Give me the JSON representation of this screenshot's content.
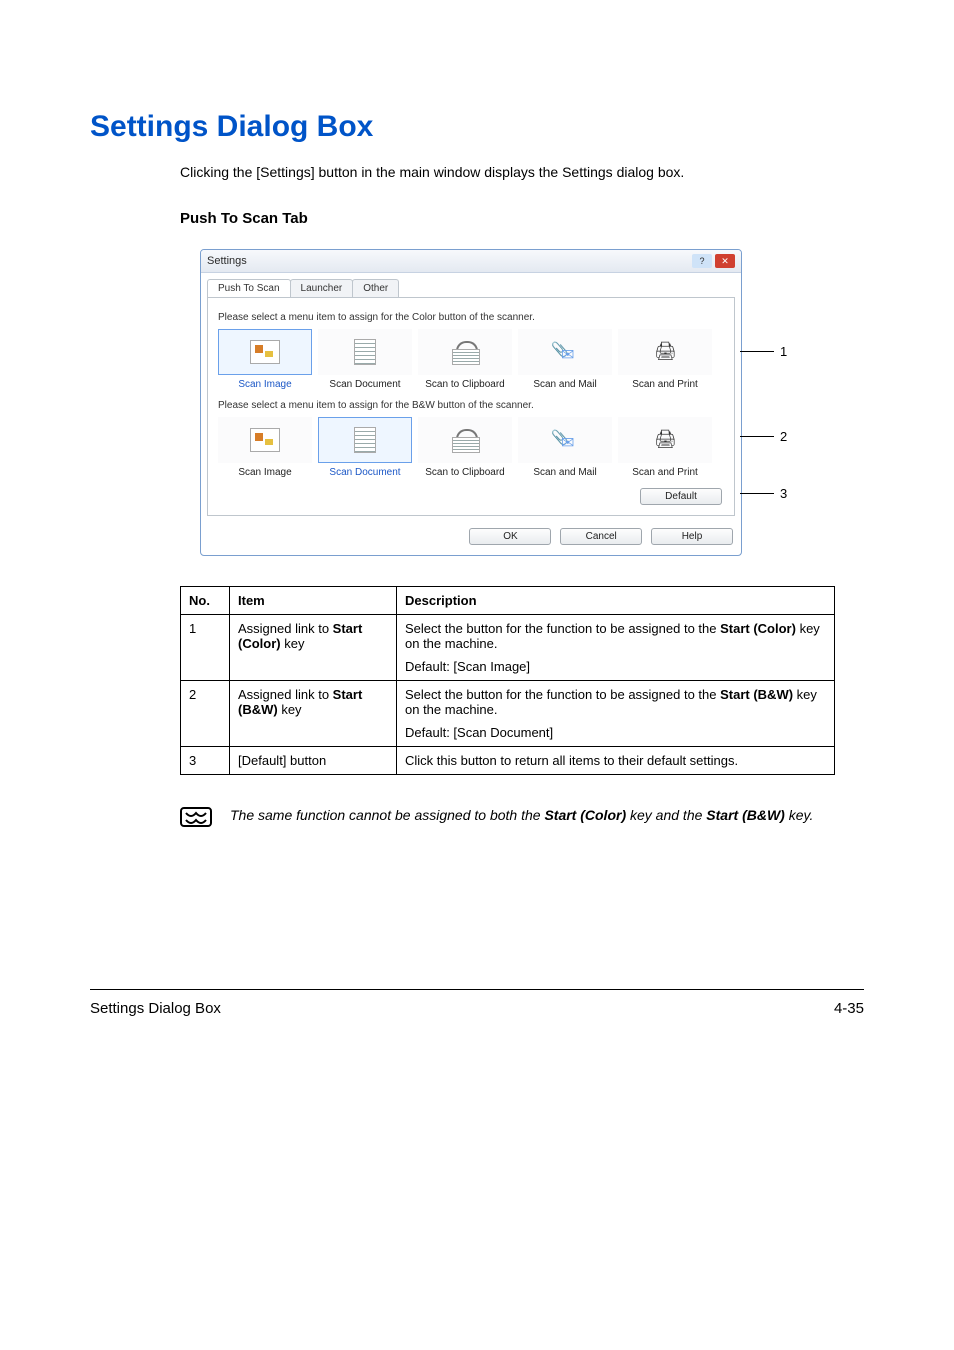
{
  "heading": "Settings Dialog Box",
  "intro": "Clicking the [Settings] button in the main window displays the Settings dialog box.",
  "subhead": "Push To Scan Tab",
  "dialog": {
    "title": "Settings",
    "win_help_label": "?",
    "win_close_label": "✕",
    "tabs": [
      {
        "label": "Push To Scan",
        "active": true
      },
      {
        "label": "Launcher",
        "active": false
      },
      {
        "label": "Other",
        "active": false
      }
    ],
    "prompt_color": "Please select a menu item to assign for the Color button of the scanner.",
    "prompt_bw": "Please select a menu item to assign for the B&W button of the scanner.",
    "options": [
      {
        "key": "image",
        "label": "Scan Image",
        "icon": "image"
      },
      {
        "key": "document",
        "label": "Scan Document",
        "icon": "doc"
      },
      {
        "key": "clip",
        "label": "Scan to Clipboard",
        "icon": "clip"
      },
      {
        "key": "mail",
        "label": "Scan and Mail",
        "icon": "mail"
      },
      {
        "key": "print",
        "label": "Scan and Print",
        "icon": "print"
      }
    ],
    "color_selected": "image",
    "bw_selected": "document",
    "default_btn": "Default",
    "ok_btn": "OK",
    "cancel_btn": "Cancel",
    "help_btn": "Help"
  },
  "callouts": {
    "one": "1",
    "two": "2",
    "three": "3"
  },
  "table": {
    "head_no": "No.",
    "head_item": "Item",
    "head_desc": "Description",
    "r1": {
      "no": "1",
      "item_line1": "Assigned link to ",
      "item_bold": "Start (Color)",
      "item_tail": " key",
      "desc_line1a": "Select the button for the function to be assigned to the ",
      "desc_bold": "Start (Color)",
      "desc_line1b": " key on the machine.",
      "desc_line2": "Default: [Scan Image]"
    },
    "r2": {
      "no": "2",
      "item_line1": "Assigned link to ",
      "item_bold": "Start (B&W)",
      "item_tail": " key",
      "desc_line1a": "Select the button for the function to be assigned to the ",
      "desc_bold": "Start (B&W)",
      "desc_line1b": " key on the machine.",
      "desc_line2": "Default: [Scan Document]"
    },
    "r3": {
      "no": "3",
      "item": "[Default] button",
      "desc": "Click this button to return all items to their default settings."
    }
  },
  "note": {
    "pre": "The same function cannot be assigned to both the ",
    "bold1": "Start (Color)",
    "mid": " key and the ",
    "bold2": "Start (B&W)",
    "post": " key."
  },
  "footer": {
    "left": "Settings Dialog Box",
    "right": "4-35"
  }
}
